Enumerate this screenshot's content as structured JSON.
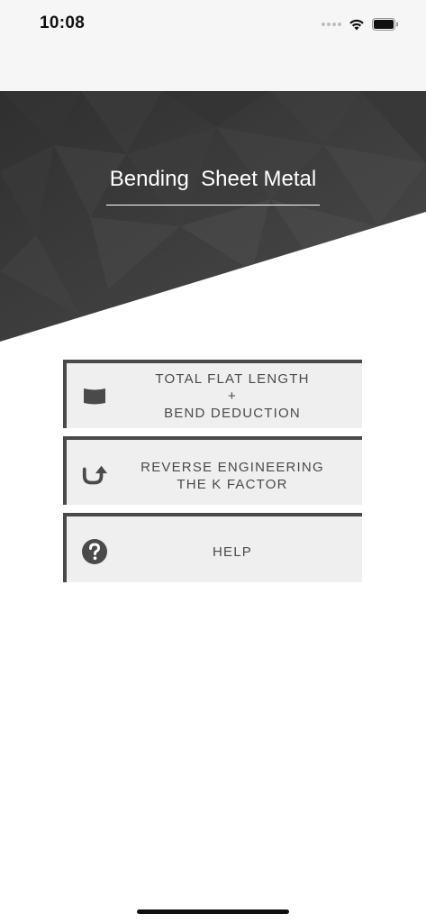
{
  "status_bar": {
    "time": "10:08"
  },
  "header": {
    "title": "Bending  Sheet Metal"
  },
  "menu": {
    "items": [
      {
        "id": "total-flat-length",
        "icon": "curved-sheet-icon",
        "line1": "TOTAL FLAT LENGTH",
        "line2": "+",
        "line3": "BEND DEDUCTION"
      },
      {
        "id": "reverse-engineering",
        "icon": "u-turn-arrow-icon",
        "line1": "REVERSE ENGINEERING",
        "line2": "THE K FACTOR"
      },
      {
        "id": "help",
        "icon": "question-circle-icon",
        "line1": "HELP"
      }
    ]
  },
  "colors": {
    "banner_dark": "#3a3a3a",
    "menu_border": "#4a4a4a",
    "menu_bg": "#efefef",
    "text": "#4a4a4a"
  }
}
